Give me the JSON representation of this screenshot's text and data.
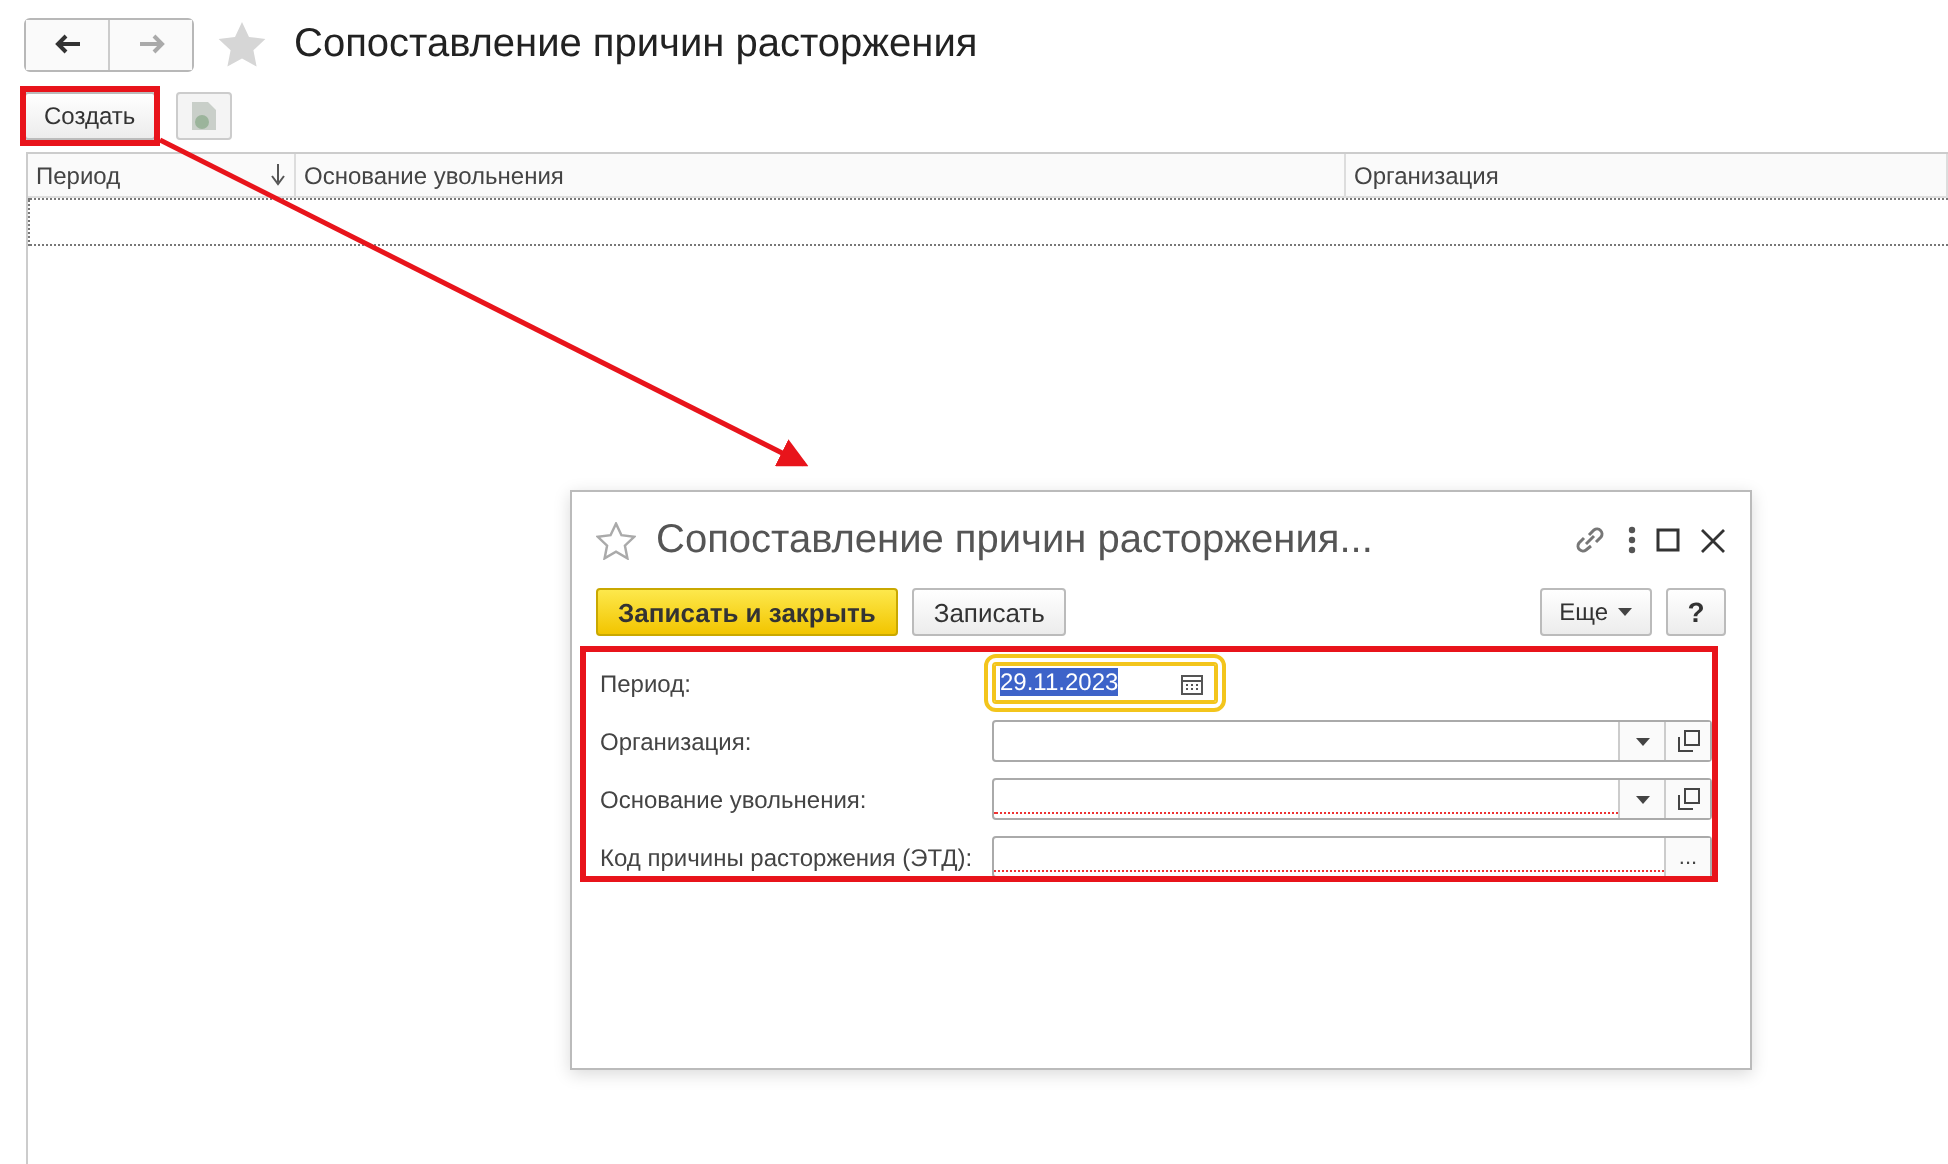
{
  "window": {
    "title": "Сопоставление причин расторжения"
  },
  "toolbar": {
    "create_button": "Создать"
  },
  "table": {
    "columns": [
      {
        "label": "Период",
        "sorted": true
      },
      {
        "label": "Основание увольнения",
        "sorted": false
      },
      {
        "label": "Организация",
        "sorted": false
      }
    ]
  },
  "dialog": {
    "title": "Сопоставление причин расторжения...",
    "buttons": [
      {
        "label": "Записать и закрыть",
        "kind": "primary"
      },
      {
        "label": "Записать",
        "kind": "normal"
      }
    ],
    "more_button": "Еще",
    "help_button": "?",
    "fields": [
      {
        "label": "Период:",
        "kind": "date",
        "value": "29.11.2023",
        "focused": true,
        "required": false
      },
      {
        "label": "Организация:",
        "kind": "select",
        "focused": false,
        "required": false
      },
      {
        "label": "Основание увольнения:",
        "kind": "select",
        "focused": false,
        "required": true
      },
      {
        "label": "Код причины расторжения (ЭТД):",
        "kind": "choice",
        "choice_button": "...",
        "focused": false,
        "required": true
      }
    ]
  }
}
